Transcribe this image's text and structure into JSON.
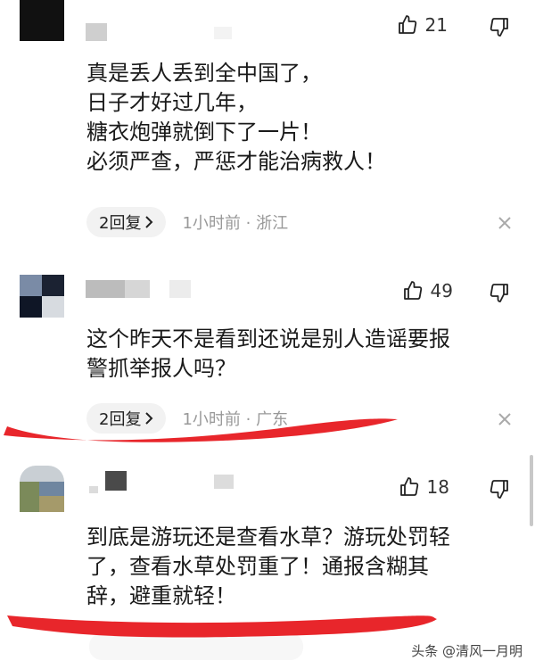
{
  "comments": [
    {
      "likes": "21",
      "text": "真是丢人丢到全中国了，\n日子才好过几年，\n糖衣炮弹就倒下了一片！\n必须严查，严惩才能治病救人！",
      "reply_label": "2回复",
      "meta": "1小时前 · 浙江"
    },
    {
      "likes": "49",
      "text": "这个昨天不是看到还说是别人造谣要报\n警抓举报人吗？",
      "reply_label": "2回复",
      "meta": "1小时前 · 广东"
    },
    {
      "likes": "18",
      "text": "到底是游玩还是查看水草？游玩处罚轻\n了，查看水草处罚重了！通报含糊其\n辞，避重就轻！",
      "reply_label": "",
      "meta": ""
    }
  ],
  "watermark": "头条 @清风一月明",
  "colors": {
    "annotation_red": "#e8262b",
    "meta_gray": "#999999"
  },
  "icons": {
    "like": "thumbs-up-icon",
    "dislike": "thumbs-down-icon",
    "close": "close-icon",
    "chevron": "chevron-right-icon"
  }
}
